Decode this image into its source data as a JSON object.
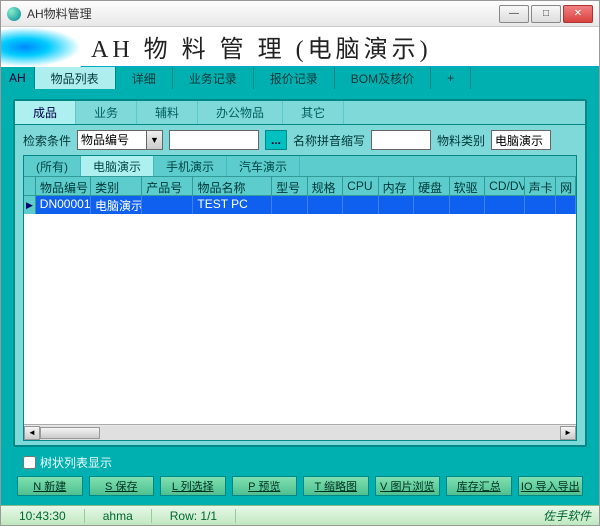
{
  "window": {
    "title": "AH物料管理"
  },
  "banner": {
    "title": "AH 物 料 管 理 (电脑演示)"
  },
  "maintabs": {
    "ah": "AH",
    "items": [
      "物品列表",
      "详细",
      "业务记录",
      "报价记录",
      "BOM及核价",
      "+"
    ],
    "active": 0
  },
  "subtabs": {
    "items": [
      "成品",
      "业务",
      "辅料",
      "办公物品",
      "其它"
    ],
    "active": 0
  },
  "filter": {
    "label_cond": "检索条件",
    "select_value": "物品编号",
    "dots": "...",
    "label_pinyin": "名称拼音缩写",
    "label_category": "物料类别",
    "category_value": "电脑演示"
  },
  "cattabs": {
    "items": [
      "(所有)",
      "电脑演示",
      "手机演示",
      "汽车演示"
    ],
    "active": 1
  },
  "grid": {
    "columns": [
      "物品编号",
      "类别",
      "产品号",
      "物品名称",
      "型号",
      "规格",
      "CPU",
      "内存",
      "硬盘",
      "软驱",
      "CD/DV",
      "声卡",
      "网"
    ],
    "widths": [
      56,
      52,
      52,
      80,
      36,
      36,
      36,
      36,
      36,
      36,
      40,
      32,
      20
    ],
    "rows": [
      {
        "mark": "▶",
        "cells": [
          "DN00001",
          "电脑演示",
          "",
          "TEST PC",
          "",
          "",
          "",
          "",
          "",
          "",
          "",
          "",
          ""
        ]
      }
    ]
  },
  "tree_check": {
    "label": "树状列表显示",
    "checked": false
  },
  "toolbar": [
    "N 新建",
    "S 保存",
    "L 列选择",
    "P 预览",
    "T 缩略图",
    "V 图片浏览",
    "库存汇总",
    "IO 导入导出"
  ],
  "status": {
    "time": "10:43:30",
    "user": "ahma",
    "row": "Row: 1/1",
    "brand": "佐手软件"
  }
}
